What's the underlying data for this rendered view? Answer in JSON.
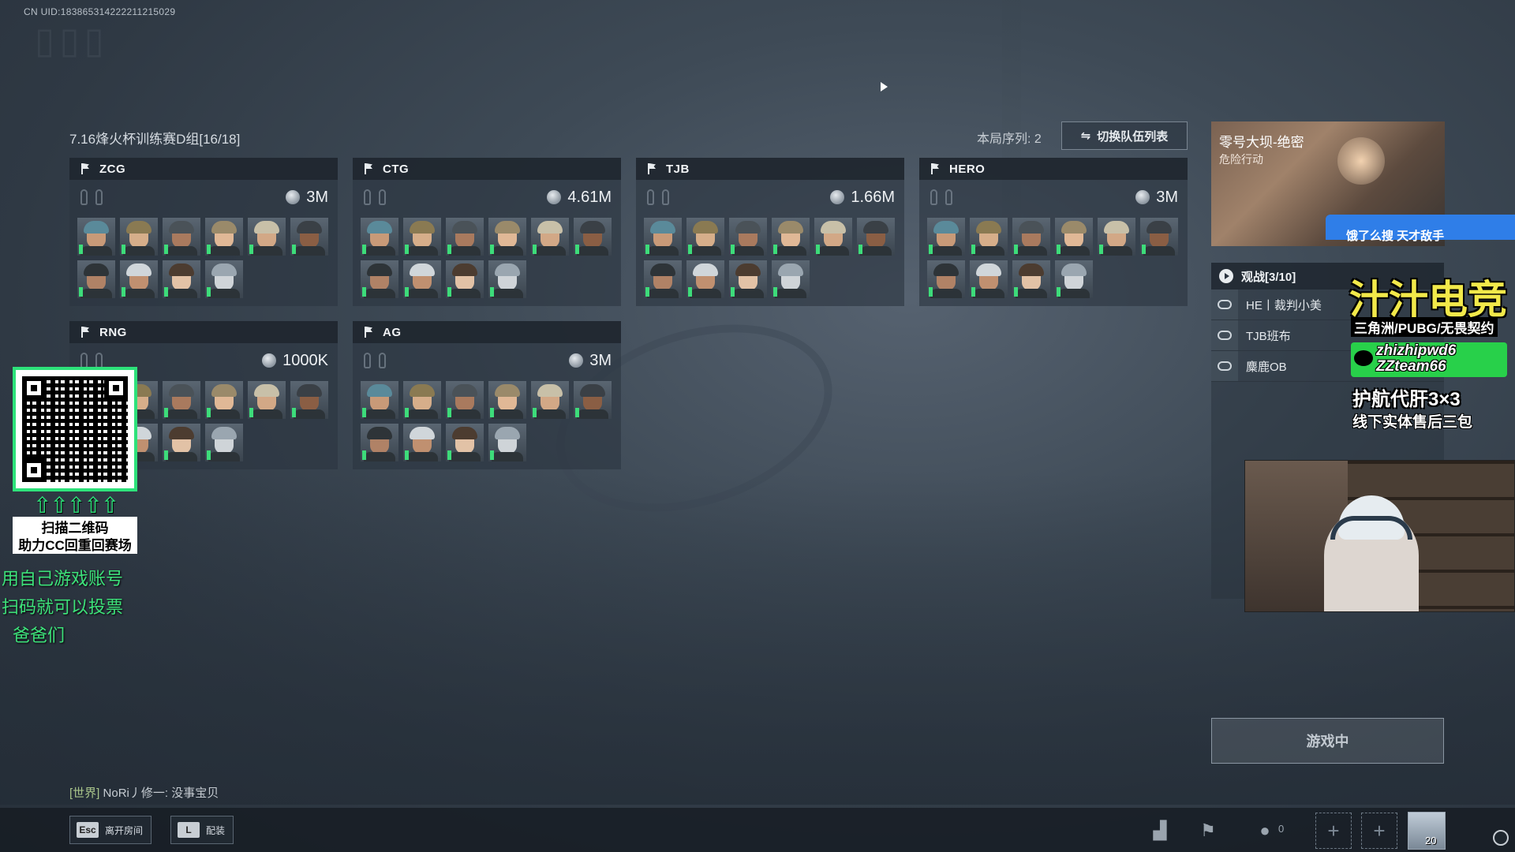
{
  "uid_text": "CN UID:183865314222211215029",
  "room_title": "7.16烽火杯训练赛D组[16/18]",
  "round_order": "本局序列: 2",
  "switch_button": "切换队伍列表",
  "teams": [
    {
      "name": "ZCG",
      "value": "3M"
    },
    {
      "name": "CTG",
      "value": "4.61M"
    },
    {
      "name": "TJB",
      "value": "1.66M"
    },
    {
      "name": "HERO",
      "value": "3M"
    },
    {
      "name": "RNG",
      "value": "1000K"
    },
    {
      "name": "AG",
      "value": "3M"
    }
  ],
  "map": {
    "name": "零号大坝-绝密",
    "mode": "危险行动",
    "overlay_text": "饿了么搜 天才敌手"
  },
  "spectate": {
    "title": "观战[3/10]",
    "entries": [
      "HE丨裁判小美",
      "TJB班布",
      "麋鹿OB"
    ]
  },
  "promo": {
    "title": "汁汁电竞",
    "subtitle": "三角洲/PUBG/无畏契约",
    "wechat1": "zhizhipwd6",
    "wechat2": "ZZteam66",
    "line3": "护航代肝3×3",
    "line4": "线下实体售后三包"
  },
  "qr": {
    "arrows": "⇧⇧⇧⇧⇧",
    "text1": "扫描二维码",
    "text2": "助力CC回重回赛场"
  },
  "green_notes": [
    "用自己游戏账号",
    "扫码就可以投票",
    "爸爸们"
  ],
  "chat": {
    "channel": "[世界]",
    "message": "NoRi丿修一: 没事宝贝"
  },
  "game_status_button": "游戏中",
  "bottom": {
    "leave_key": "Esc",
    "leave_label": "离开房间",
    "loadout_key": "L",
    "loadout_label": "配装",
    "friend_count": "0",
    "profile_level": "20"
  },
  "colors": {
    "status_green": "#3ddc7a",
    "promo_yellow": "#f2e94a",
    "qr_border": "#2de27a"
  },
  "icons": [
    "flag-icon",
    "pin-icon",
    "coin-icon",
    "play-icon",
    "gamepad-icon",
    "chart-icon",
    "banner-icon",
    "friends-icon",
    "plus-icon",
    "swap-icon",
    "wechat-icon"
  ]
}
